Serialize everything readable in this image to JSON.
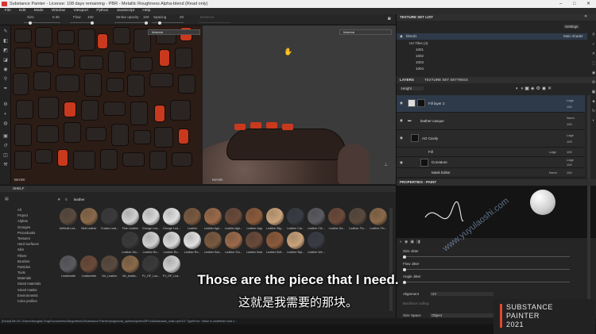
{
  "titlebar": {
    "title": "Substance Painter - License: 108 days remaining - PBR - Metallic Roughness Alpha-blend (Read only)",
    "minimize": "–",
    "maximize": "□",
    "close": "✕"
  },
  "menu": [
    "File",
    "Edit",
    "Mode",
    "Window",
    "Viewport",
    "Python",
    "JavaScript",
    "Help"
  ],
  "toolbar": {
    "size_label": "Size",
    "size_value": "0.36",
    "flow_label": "Flow",
    "flow_value": "100",
    "stroke_opacity_label": "Stroke opacity",
    "stroke_opacity_value": "100",
    "spacing_label": "Spacing",
    "spacing_value": "20",
    "distance_label": "Distance"
  },
  "viewport": {
    "left_dropdown": "Material",
    "right_dropdown": "Material",
    "left_label": "MASK",
    "right_label": "MASK"
  },
  "texture_set_list": {
    "header": "TEXTURE SET LIST",
    "settings": "Settings",
    "set_name": "blend1",
    "shader": "Main shader",
    "uv_tiles": "UV Tiles (4)",
    "tiles": [
      "1001",
      "1002",
      "1003",
      "1004"
    ]
  },
  "layers": {
    "tab1": "LAYERS",
    "tab2": "TEXTURE SET SETTINGS",
    "channel": "Height",
    "items": [
      {
        "name": "Fill layer 2",
        "blend": "Ldge",
        "opacity": "100"
      },
      {
        "name": "leather-casque",
        "blend": "Norm",
        "opacity": "100"
      },
      {
        "name": "AO Cavity",
        "blend": "Ldge",
        "opacity": "100"
      },
      {
        "name": "Fill",
        "blend": "Ldge",
        "opacity": "100"
      },
      {
        "name": "Curvature",
        "blend": "Ldge",
        "opacity": "100"
      },
      {
        "name": "Mask Editor",
        "blend": "Norm",
        "opacity": "100"
      }
    ]
  },
  "properties": {
    "header": "PROPERTIES - PAINT",
    "size_jitter": "Size Jitter",
    "flow_jitter": "Flow Jitter",
    "angle_jitter": "Angle Jitter",
    "alignment_label": "Alignment",
    "alignment_value": "UV",
    "backface_label": "Backface culling",
    "size_space_label": "Size Space",
    "size_space_value": "Object"
  },
  "shelf": {
    "header": "SHELF",
    "search": "leather",
    "categories": [
      "All",
      "Project",
      "Alphas",
      "Grunges",
      "Procedurals",
      "Textures",
      "Hard Surfaces",
      "Skin",
      "Filters",
      "Brushes",
      "Particles",
      "Tools",
      "Materials",
      "Smart materials",
      "Smart masks",
      "Environments",
      "Color profiles"
    ],
    "materials": [
      "Artificial Lea...",
      "Bell Leather",
      "Cracks Leat...",
      "Fine Leather",
      "Grunge Lea...",
      "Grunge Lea...",
      "Leather",
      "Leather Age...",
      "Leather Age...",
      "Leather bag",
      "Leather Big...",
      "Leather Cal...",
      "Leather Cle...",
      "Leather Da...",
      "Leather Fin...",
      "Leather Fin...",
      "Leather Mo...",
      "Leather Ro...",
      "Leather Ro...",
      "Leather Ro...",
      "Leather Sea...",
      "Leather Sm...",
      "Leather Sofa",
      "Leather Soft...",
      "Leather Styl...",
      "Leather We...",
      "Leatherette",
      "Leatherette",
      "Mx_Leather",
      "Mx_leathe...",
      "PJ_GP_Lea...",
      "PJ_GP_Lea..."
    ]
  },
  "status": "[Script] file:///C:/Users/Naughty Dog/Documents/Allegorithmic/Substance Painter/plugins/sd_splines/qml/toISPLinkData/auto_main.qml:10: TypeError: Value is undefined and c...",
  "subtitles": {
    "en": "Those are the piece that I need.",
    "zh": "这就是我需要的那块。"
  },
  "watermark": "www.yuyulaoshi.com",
  "logo": {
    "line1": "SUBSTANCE",
    "line2": "PAINTER",
    "line3": "2021"
  },
  "colors": {
    "accent": "#c9391e",
    "selection": "#2e3a4a",
    "logo_accent": "#e4472f"
  }
}
